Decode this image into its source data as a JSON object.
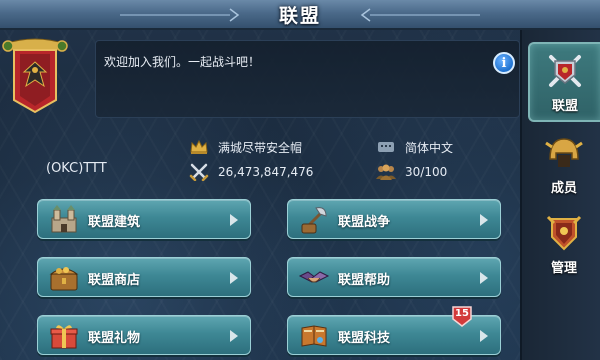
{
  "window": {
    "title": "联盟"
  },
  "alliance": {
    "description": "欢迎加入我们。一起战斗吧！",
    "name": "(OKC)TTT",
    "leader": "满城尽带安全帽",
    "power": "26,473,847,476",
    "language": "简体中文",
    "members": "30/100"
  },
  "tabs": [
    {
      "label": "联盟",
      "icon": "alliance-crest-icon",
      "active": true
    },
    {
      "label": "成员",
      "icon": "helmet-icon",
      "active": false
    },
    {
      "label": "管理",
      "icon": "shield-crest-icon",
      "active": false
    }
  ],
  "actions": [
    {
      "label": "联盟建筑",
      "icon": "castle-icon"
    },
    {
      "label": "联盟战争",
      "icon": "war-axe-icon"
    },
    {
      "label": "联盟商店",
      "icon": "chest-icon"
    },
    {
      "label": "联盟帮助",
      "icon": "handshake-icon"
    },
    {
      "label": "联盟礼物",
      "icon": "gift-icon"
    },
    {
      "label": "联盟科技",
      "icon": "book-icon",
      "badge": "15"
    }
  ],
  "colors": {
    "accent": "#3e8895",
    "badge": "#d23a3a",
    "gold": "#e0b144"
  }
}
